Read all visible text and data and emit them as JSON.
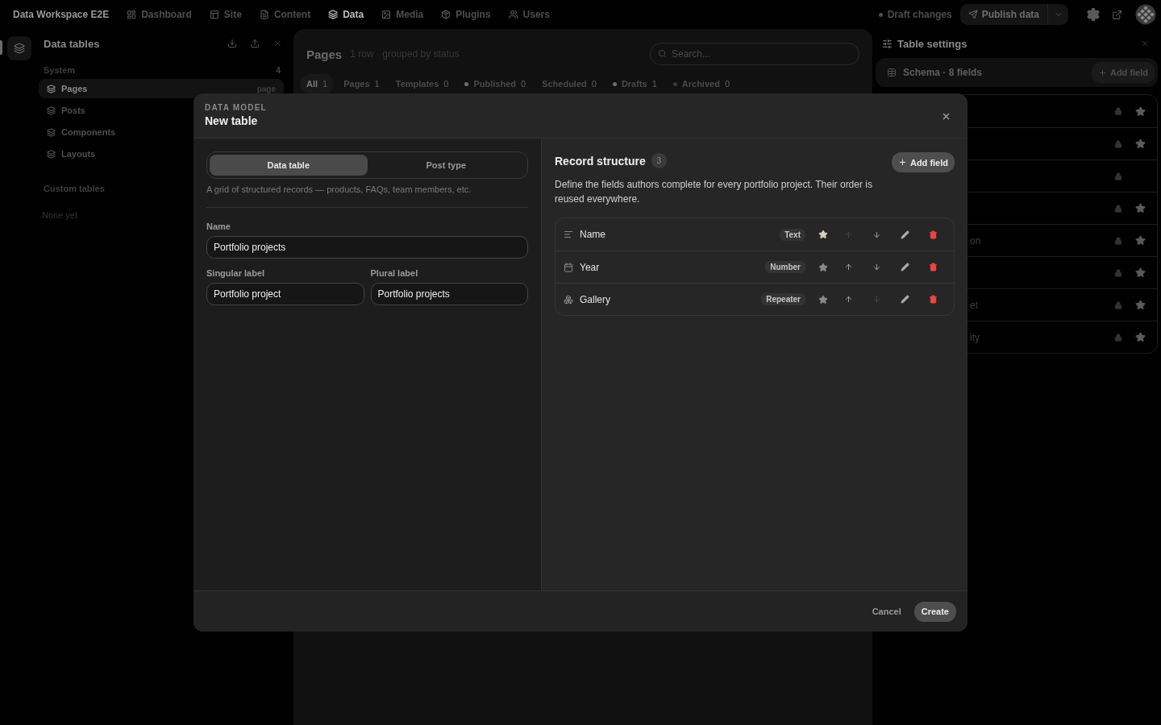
{
  "app_bar": {
    "workspace": "Data Workspace E2E",
    "nav": [
      {
        "label": "Dashboard",
        "kind": "dashboard",
        "selected": false
      },
      {
        "label": "Site",
        "kind": "site",
        "selected": false
      },
      {
        "label": "Content",
        "kind": "content",
        "selected": false
      },
      {
        "label": "Data",
        "kind": "data",
        "selected": true
      },
      {
        "label": "Media",
        "kind": "media",
        "selected": false
      },
      {
        "label": "Plugins",
        "kind": "plugins",
        "selected": false
      },
      {
        "label": "Users",
        "kind": "users",
        "selected": false
      }
    ],
    "status": "Draft changes",
    "publish_button": "Publish data"
  },
  "sidebar": {
    "title": "Data tables",
    "sections": [
      {
        "title": "System",
        "count": "4",
        "items": [
          {
            "label": "Pages",
            "tag": "page",
            "selected": true
          },
          {
            "label": "Posts",
            "selected": false
          },
          {
            "label": "Components",
            "selected": false
          },
          {
            "label": "Layouts",
            "selected": false
          }
        ]
      },
      {
        "title": "Custom tables",
        "empty_text": "None yet"
      }
    ]
  },
  "table_panel": {
    "title": "Pages",
    "subtitle": "1 row · grouped by status",
    "search": {
      "placeholder": "Search..."
    },
    "filters": [
      {
        "label": "All",
        "count": "1",
        "selected": true
      },
      {
        "label": "Pages",
        "count": "1",
        "selected": false
      },
      {
        "label": "Templates",
        "count": "0",
        "selected": false
      },
      {
        "label": "Published",
        "count": "0",
        "selected": false,
        "color": "#6e6e6e"
      },
      {
        "label": "Scheduled",
        "count": "0",
        "selected": false
      },
      {
        "label": "Drafts",
        "count": "1",
        "selected": false,
        "color": "#6e6e6e"
      },
      {
        "label": "Archived",
        "count": "0",
        "selected": false,
        "color": "#3a3a3a"
      }
    ]
  },
  "settings_panel": {
    "title": "Table settings",
    "schema": {
      "label": "Schema · 8 fields",
      "add_button": "Add field"
    },
    "rows": [
      {
        "star": true
      },
      {
        "star": true
      },
      {
        "star": false
      },
      {
        "star": true
      },
      {
        "label": "on",
        "star": true
      },
      {
        "star": true
      },
      {
        "label": "et",
        "star": true
      },
      {
        "label": "ity",
        "star": true
      }
    ]
  },
  "dialog": {
    "overline": "DATA MODEL",
    "title": "New table",
    "modes": [
      {
        "label": "Data table",
        "selected": true
      },
      {
        "label": "Post type",
        "selected": false
      }
    ],
    "mode_hint": "A grid of structured records — products, FAQs, team members, etc.",
    "name": {
      "label": "Name",
      "value": "Portfolio projects"
    },
    "singular": {
      "label": "Singular label",
      "value": "Portfolio project"
    },
    "plural": {
      "label": "Plural label",
      "value": "Portfolio projects"
    },
    "structure": {
      "title": "Record structure",
      "count": "3",
      "add_button": "Add field",
      "description": "Define the fields authors complete for every portfolio project. Their order is reused everywhere.",
      "fields": [
        {
          "name": "Name",
          "type": "Text",
          "kind": "text",
          "primary": true,
          "can_move_up": false,
          "can_move_down": true
        },
        {
          "name": "Year",
          "type": "Number",
          "kind": "number",
          "primary": false,
          "can_move_up": true,
          "can_move_down": true
        },
        {
          "name": "Gallery",
          "type": "Repeater",
          "kind": "repeater",
          "primary": false,
          "can_move_up": true,
          "can_move_down": false
        }
      ]
    },
    "cancel_button": "Cancel",
    "create_button": "Create"
  }
}
